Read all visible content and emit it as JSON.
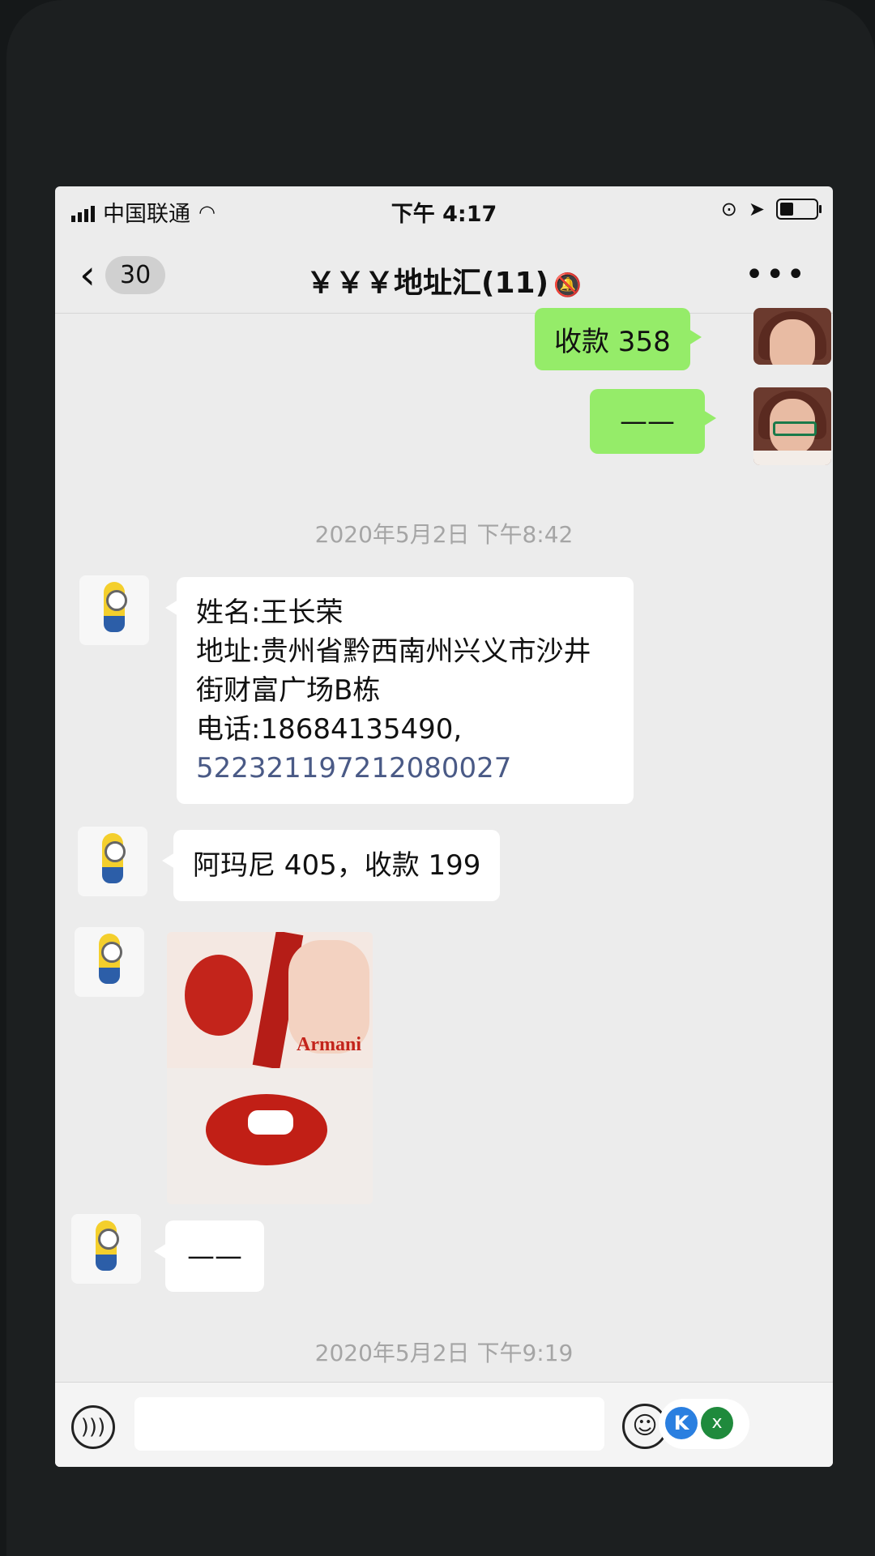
{
  "status_bar": {
    "carrier": "中国联通",
    "time": "下午 4:17"
  },
  "nav": {
    "back_count": "30",
    "title": "￥￥￥地址汇(11)"
  },
  "messages": {
    "top_partial": "收款 358",
    "dash1": "——",
    "timestamp1": "2020年5月2日 下午8:42",
    "address_lines": [
      "姓名:王长荣",
      "地址:贵州省黔西南州兴义市沙井",
      "街财富广场B栋",
      "电话:18684135490,",
      "522321197212080027"
    ],
    "order": "阿玛尼 405，收款 199",
    "photo_brand": "Armani",
    "dash2": "——",
    "timestamp2": "2020年5月2日 下午9:19"
  },
  "input_bar": {
    "float_k": "K",
    "float_x": "x"
  }
}
